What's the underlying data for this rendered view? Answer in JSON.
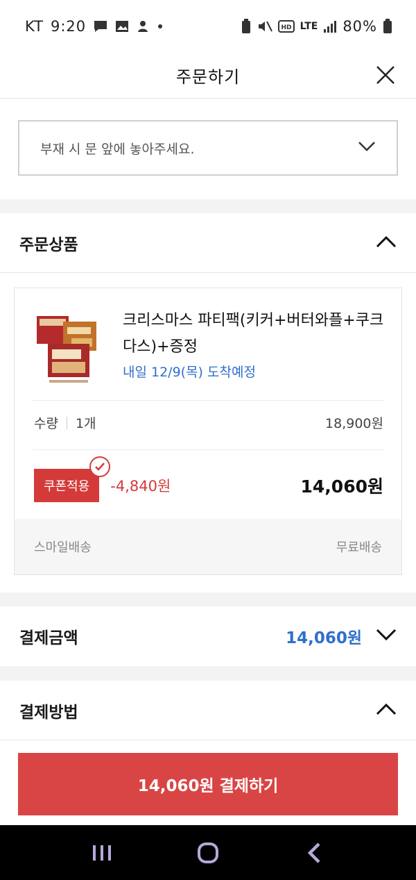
{
  "status": {
    "carrier": "KT",
    "time": "9:20",
    "network": "LTE",
    "battery": "80%"
  },
  "header": {
    "title": "주문하기"
  },
  "delivery_request": {
    "value": "부재 시 문 앞에 놓아주세요."
  },
  "order_items": {
    "title": "주문상품",
    "product": {
      "name": "크리스마스 파티팩(키커+버터와플+쿠크다스)+증정",
      "arrival": "내일 12/9(목) 도착예정",
      "quantity_label": "수량",
      "quantity": "1개",
      "original_price": "18,900원",
      "coupon_label": "쿠폰적용",
      "discount": "-4,840원",
      "final_price": "14,060원",
      "shipping_type": "스마일배송",
      "shipping_fee": "무료배송"
    }
  },
  "payment_amount": {
    "title": "결제금액",
    "amount": "14,060원"
  },
  "payment_method": {
    "title": "결제방법"
  },
  "pay_button": {
    "label": "14,060원 결제하기"
  },
  "colors": {
    "accent_red": "#d94545",
    "accent_blue": "#2f6fcd"
  },
  "icons": {
    "message": "message-icon",
    "gallery": "gallery-icon",
    "close": "close-icon",
    "chevron_down": "chevron-down-icon",
    "chevron_up": "chevron-up-icon",
    "check": "check-icon",
    "recents": "recents-icon",
    "home": "home-icon",
    "back": "back-icon"
  }
}
